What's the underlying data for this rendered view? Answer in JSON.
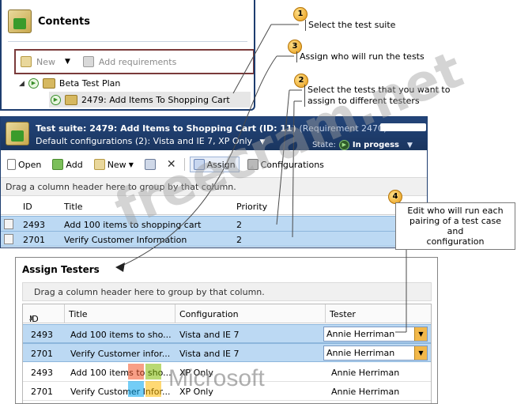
{
  "contents": {
    "title": "Contents",
    "new_label": "New",
    "add_requirements_label": "Add requirements",
    "plan_label": "Beta Test Plan",
    "suite_label": "2479: Add Items To Shopping Cart"
  },
  "suite": {
    "header_title": "Test suite:  2479: Add Items to Shopping Cart (ID: 11)",
    "header_requirement": "(Requirement 2470)",
    "configurations_text": "Default configurations (2): Vista and IE 7, XP Only",
    "state_label": "State:",
    "state_value": "In progess",
    "toolbar": {
      "open": "Open",
      "add": "Add",
      "new": "New",
      "assign": "Assign",
      "configurations": "Configurations"
    },
    "group_hint": "Drag a column header here to group by that column.",
    "columns": {
      "id": "ID",
      "title": "Title",
      "priority": "Priority"
    },
    "rows": [
      {
        "id": "2493",
        "title": "Add 100 items to shopping cart",
        "priority": "2"
      },
      {
        "id": "2701",
        "title": "Verify Customer Information",
        "priority": "2"
      }
    ]
  },
  "assign": {
    "title": "Assign Testers",
    "group_hint": "Drag a column header here to group by that column.",
    "columns": {
      "id": "ID",
      "title": "Title",
      "configuration": "Configuration",
      "tester": "Tester"
    },
    "rows": [
      {
        "id": "2493",
        "title": "Add 100 items to sho...",
        "configuration": "Vista and IE 7",
        "tester": "Annie Herriman"
      },
      {
        "id": "2701",
        "title": "Verify Customer infor...",
        "configuration": "Vista and IE 7",
        "tester": "Annie Herriman"
      },
      {
        "id": "2493",
        "title": "Add 100 items to sho...",
        "configuration": "XP Only",
        "tester": "Annie Herriman"
      },
      {
        "id": "2701",
        "title": "Verify Customer Infor...",
        "configuration": "XP Only",
        "tester": "Annie Herriman"
      }
    ]
  },
  "callouts": {
    "c1_num": "1",
    "c1_text": "Select the test suite",
    "c2_num": "2",
    "c2_text_line1": "Select the tests that you want to",
    "c2_text_line2": "assign to different testers",
    "c3_num": "3",
    "c3_text": "Assign who will run the tests",
    "c4_num": "4",
    "c4_line1": "Edit who will run each",
    "c4_line2": "pairing of a test case and",
    "c4_line3": "configuration"
  },
  "watermark": {
    "site": "freecram.net",
    "brand": "Microsoft",
    "logo_colors": [
      "#f25022",
      "#7fba00",
      "#00a4ef",
      "#ffb900"
    ]
  },
  "icons": [
    "book-icon",
    "play-icon",
    "folder-icon",
    "open-icon",
    "add-icon",
    "new-icon",
    "copy-icon",
    "delete-icon",
    "assign-icon",
    "configurations-icon",
    "dropdown-icon"
  ]
}
